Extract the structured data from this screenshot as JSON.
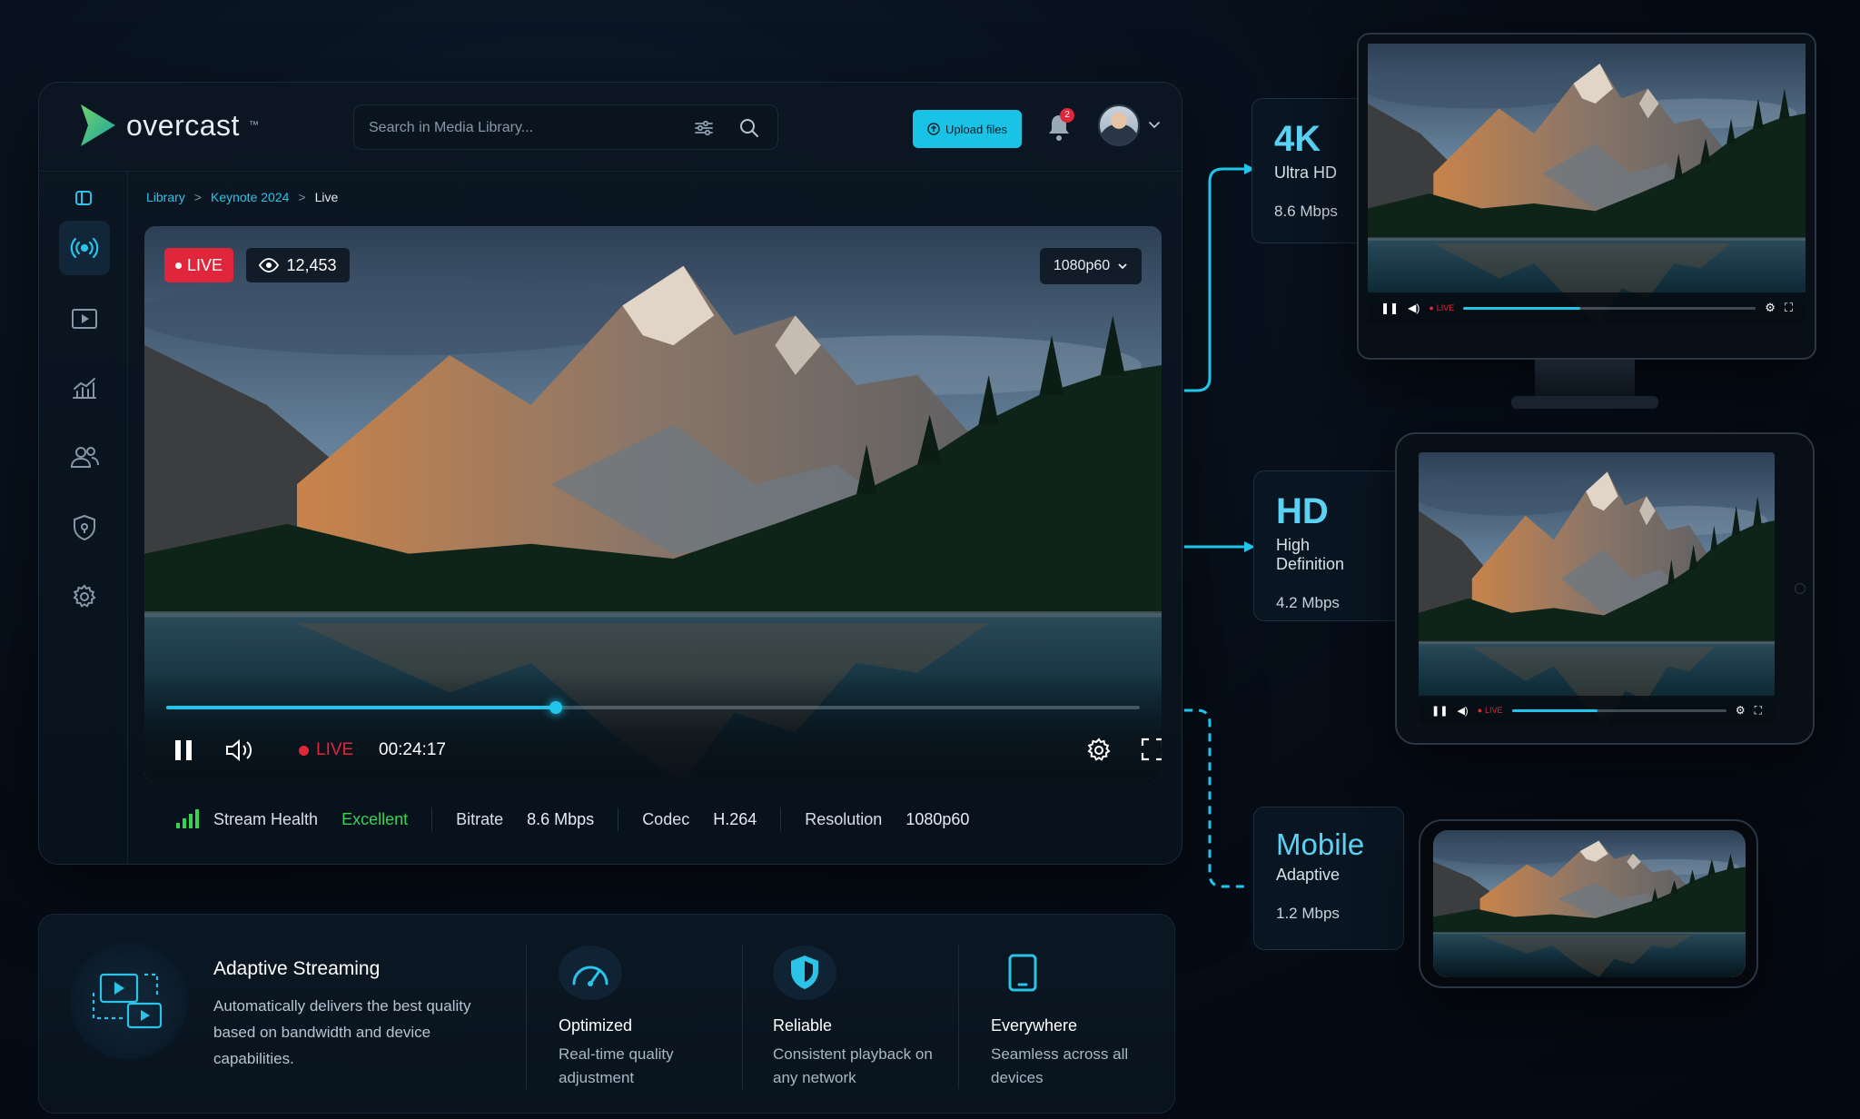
{
  "app": {
    "brand": "overcast",
    "brand_tm": "™",
    "search_placeholder": "Search in Media Library...",
    "upload_label": "Upload files",
    "notifications_count": "2"
  },
  "breadcrumb": {
    "items": [
      "Library",
      "Keynote 2024"
    ],
    "current": "Live",
    "separator": ">"
  },
  "player": {
    "live_badge": "LIVE",
    "viewers": "12,453",
    "quality": "1080p60",
    "live_indicator": "LIVE",
    "timecode": "00:24:17",
    "progress_fraction": 0.4
  },
  "stats": {
    "health_label": "Stream Health",
    "health_value": "Excellent",
    "bitrate_label": "Bitrate",
    "bitrate_value": "8.6 Mbps",
    "codec_label": "Codec",
    "codec_value": "H.264",
    "resolution_label": "Resolution",
    "resolution_value": "1080p60"
  },
  "features": {
    "main_title": "Adaptive Streaming",
    "main_desc": "Automatically delivers the best quality based on bandwidth and device capabilities.",
    "items": [
      {
        "title": "Optimized",
        "desc": "Real-time quality adjustment",
        "icon": "speedometer-icon"
      },
      {
        "title": "Reliable",
        "desc": "Consistent playback on any network",
        "icon": "shield-icon"
      },
      {
        "title": "Everywhere",
        "desc": "Seamless across all devices",
        "icon": "tablet-icon"
      }
    ]
  },
  "tiers": [
    {
      "name": "4K",
      "sub": "Ultra HD",
      "rate": "8.6 Mbps"
    },
    {
      "name": "HD",
      "sub": "High Definition",
      "rate": "4.2 Mbps"
    },
    {
      "name": "Mobile",
      "sub": "Adaptive",
      "rate": "1.2 Mbps"
    }
  ],
  "device_players": {
    "live_label": "LIVE"
  },
  "colors": {
    "accent": "#1fc6ea",
    "live_red": "#e0263b",
    "healthy_green": "#39d353",
    "background": "#060d17"
  }
}
